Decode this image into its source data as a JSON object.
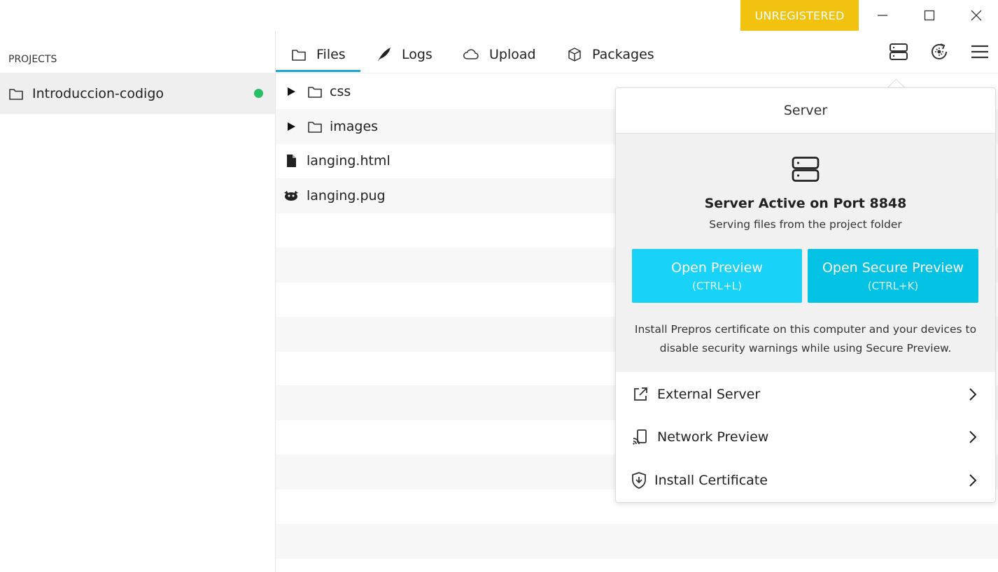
{
  "window": {
    "unregistered_label": "UNREGISTERED"
  },
  "sidebar": {
    "heading": "PROJECTS",
    "projects": [
      {
        "name": "Introduccion-codigo",
        "status_color": "#27c065"
      }
    ]
  },
  "tabs": [
    {
      "label": "Files",
      "icon": "folder-icon",
      "active": true
    },
    {
      "label": "Logs",
      "icon": "feather-icon"
    },
    {
      "label": "Upload",
      "icon": "cloud-icon"
    },
    {
      "label": "Packages",
      "icon": "package-icon"
    }
  ],
  "toolbar": {
    "icons": [
      "server-icon",
      "live-reload-icon",
      "hamburger-menu-icon"
    ]
  },
  "files": [
    {
      "name": "css",
      "type": "folder"
    },
    {
      "name": "images",
      "type": "folder"
    },
    {
      "name": "langing.html",
      "type": "file"
    },
    {
      "name": "langing.pug",
      "type": "pug"
    }
  ],
  "server_panel": {
    "title": "Server",
    "status_title": "Server Active on Port 8848",
    "status_subtitle": "Serving files from the project folder",
    "open_preview": {
      "label": "Open Preview",
      "shortcut": "(CTRL+L)",
      "color": "#18d2f8"
    },
    "open_secure_preview": {
      "label": "Open Secure Preview",
      "shortcut": "(CTRL+K)",
      "color": "#04c2e4"
    },
    "certificate_note": "Install Prepros certificate on this computer and your devices to disable security warnings while using Secure Preview.",
    "menu": [
      {
        "label": "External Server",
        "icon": "external-link-icon"
      },
      {
        "label": "Network Preview",
        "icon": "cast-icon"
      },
      {
        "label": "Install Certificate",
        "icon": "shield-download-icon"
      }
    ]
  },
  "colors": {
    "accent": "#1aa7dc",
    "unregistered_bg": "#f2c211"
  }
}
